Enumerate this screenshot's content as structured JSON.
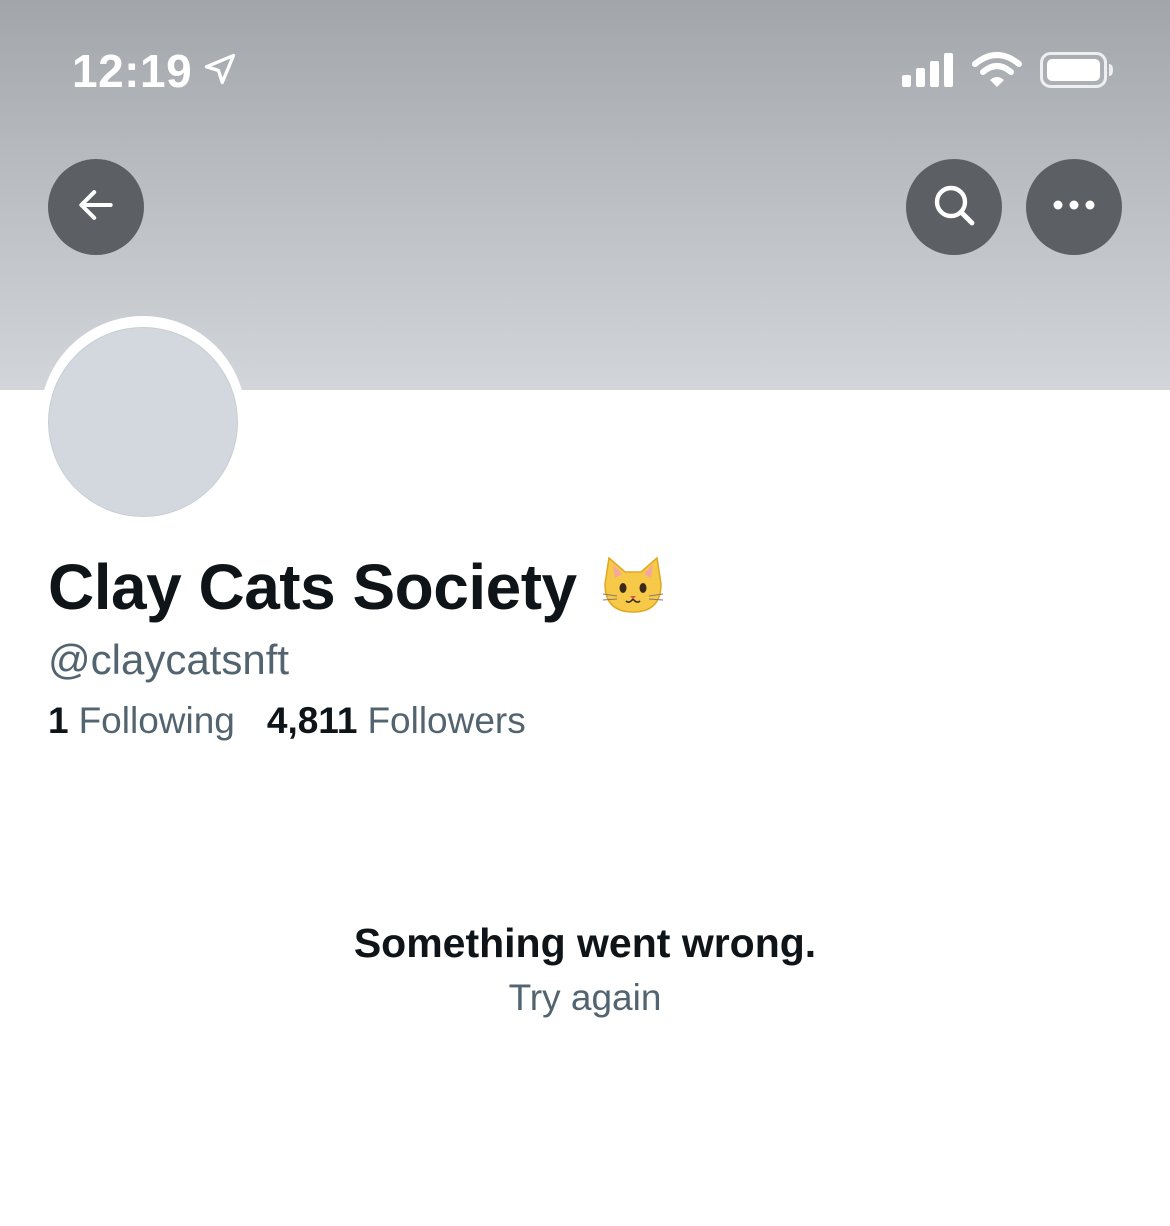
{
  "status_bar": {
    "time": "12:19",
    "icons": [
      "location-arrow-icon",
      "cellular-signal-icon",
      "wifi-icon",
      "battery-icon"
    ]
  },
  "header": {
    "back_icon": "arrow-left-icon",
    "search_icon": "search-icon",
    "more_icon": "more-horizontal-icon"
  },
  "profile": {
    "display_name": "Clay Cats Society",
    "name_emoji": "🐱",
    "handle": "@claycatsnft",
    "following_count": "1",
    "following_label": "Following",
    "followers_count": "4,811",
    "followers_label": "Followers"
  },
  "error": {
    "title": "Something went wrong.",
    "retry_label": "Try again"
  },
  "colors": {
    "banner_top": "#a2a6aa",
    "banner_bottom": "#d2d6da",
    "button_bg": "#5c6064",
    "primary_text": "#0f1419",
    "secondary_text": "#536471",
    "avatar_placeholder": "#d2d8de"
  }
}
